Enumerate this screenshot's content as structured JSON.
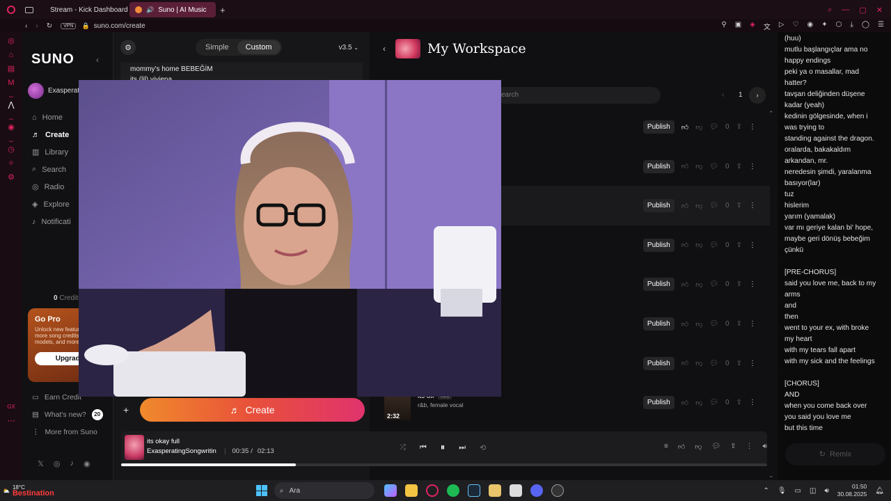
{
  "browser": {
    "tabs": [
      {
        "label": "Stream - Kick Dashboard"
      },
      {
        "label": "Suno | AI Music"
      }
    ],
    "new_tab": "+",
    "vpn": "VPN",
    "url": "suno.com/create"
  },
  "suno": {
    "logo": "SUNO",
    "username": "Exasperati",
    "nav": [
      {
        "label": "Home",
        "icon": "home-icon"
      },
      {
        "label": "Create",
        "icon": "create-icon"
      },
      {
        "label": "Library",
        "icon": "library-icon"
      },
      {
        "label": "Search",
        "icon": "search-icon"
      },
      {
        "label": "Radio",
        "icon": "radio-icon"
      },
      {
        "label": "Explore",
        "icon": "explore-icon"
      },
      {
        "label": "Notificati",
        "icon": "bell-icon"
      }
    ],
    "credits": "0",
    "credits_label": "Credits",
    "gopro": {
      "title": "Go Pro",
      "text1": "Unlock new featur",
      "text2": "more song credits,",
      "text3": "models, and more!",
      "button": "Upgrade"
    },
    "footer_nav": [
      {
        "label": "Earn Credit"
      },
      {
        "label": "What's new?",
        "badge": "20"
      },
      {
        "label": "More from Suno"
      }
    ]
  },
  "create_panel": {
    "mode_simple": "Simple",
    "mode_custom": "Custom",
    "version": "v3.5",
    "lyrics_line1": "mommy's home BEBEĞİM",
    "lyrics_line2": "its (lil) viviena",
    "create_button": "Create"
  },
  "workspace": {
    "title": "My Workspace",
    "search_placeholder": "earch",
    "page": "1",
    "rows": [
      {
        "publish": "Publish",
        "comments": "0"
      },
      {
        "publish": "Publish",
        "comments": "0"
      },
      {
        "publish": "Publish",
        "comments": "0"
      },
      {
        "publish": "Publish",
        "comments": "0"
      },
      {
        "publish": "Publish",
        "comments": "0"
      },
      {
        "publish": "Publish",
        "comments": "0"
      },
      {
        "publish": "Publish",
        "comments": "0"
      },
      {
        "publish": "Publish",
        "comments": "0"
      }
    ],
    "last_song": {
      "title": "its ok",
      "version": "v3.5",
      "tags": "r&b, female vocal",
      "duration": "2:32"
    }
  },
  "lyrics_panel": {
    "lines": [
      "(huu)",
      "mutlu başlangıçlar ama no",
      "happy endings",
      "peki ya o masallar, mad",
      "hatter?",
      "tavşan deliğinden düşene",
      "kadar (yeah)",
      "kedinin gölgesinde, when i",
      "was trying to",
      "standing against the dragon.",
      "oralarda, bakakaldım",
      "arkandan, mr.",
      "neredesin şimdi, yaralanma",
      "basıyor(lar)",
      "tuz",
      "hislerim",
      "yarım (yamalak)",
      "var mı geriye kalan bi' hope,",
      "maybe geri dönüş bebeğim",
      "çünkü",
      "",
      "[PRE-CHORUS]",
      "said you love me, back to my",
      "arms",
      "and",
      "then",
      "went to your ex, with broke",
      "my heart",
      "with my tears fall apart",
      "with my sick and the feelings",
      "",
      "[CHORUS]",
      "AND",
      "when you come back over",
      "you said you love me",
      "but this time"
    ],
    "remix": "Remix"
  },
  "player": {
    "title": "its okay full",
    "artist": "ExasperatingSongwriting",
    "current": "00:35",
    "separator": "/",
    "total": "02:13",
    "progress": 0.27
  },
  "taskbar": {
    "weather_temp": "18°C",
    "weather_badge": "Bestination",
    "search": "Ara",
    "time": "01:50",
    "date": "30.08.2025"
  }
}
